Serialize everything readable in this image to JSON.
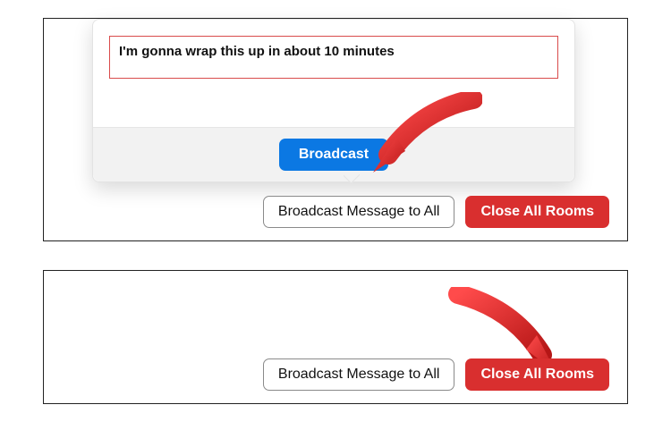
{
  "popover": {
    "message": "I'm gonna wrap this up in about 10 minutes",
    "submit_label": "Broadcast"
  },
  "buttons": {
    "broadcast_all_label": "Broadcast Message to All",
    "close_all_label": "Close All Rooms"
  },
  "colors": {
    "primary_blue": "#0b78e3",
    "danger_red": "#d92f2f",
    "highlight_border": "#d94b4b",
    "arrow_red": "#e02e2e"
  }
}
